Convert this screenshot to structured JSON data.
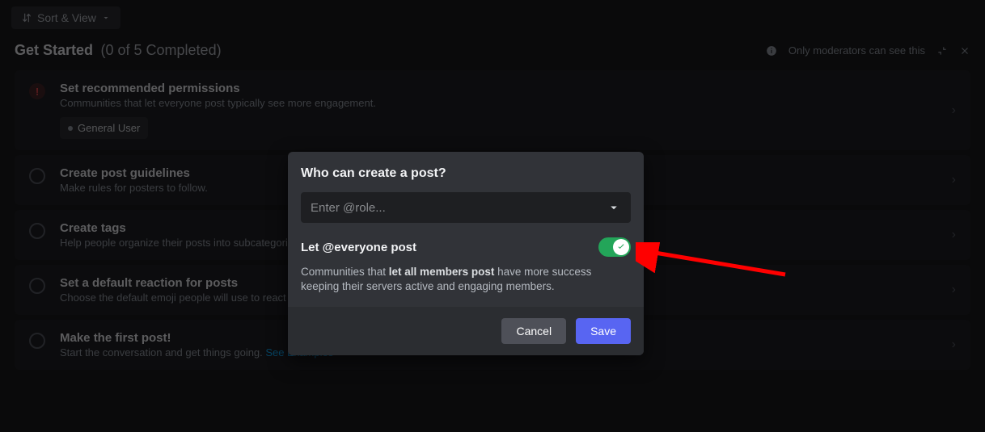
{
  "toolbar": {
    "sort_view": "Sort & View"
  },
  "header": {
    "title": "Get Started",
    "progress": "(0 of 5 Completed)",
    "mod_note": "Only moderators can see this"
  },
  "checklist": [
    {
      "title": "Set recommended permissions",
      "sub": "Communities that let everyone post typically see more engagement.",
      "chip": "General User",
      "warn": true
    },
    {
      "title": "Create post guidelines",
      "sub": "Make rules for posters to follow."
    },
    {
      "title": "Create tags",
      "sub": "Help people organize their posts into subcategories."
    },
    {
      "title": "Set a default reaction for posts",
      "sub": "Choose the default emoji people will use to react to posts."
    },
    {
      "title": "Make the first post!",
      "sub_prefix": "Start the conversation and get things going. ",
      "link": "See Examples"
    }
  ],
  "modal": {
    "title": "Who can create a post?",
    "role_placeholder": "Enter @role...",
    "toggle_label": "Let @everyone post",
    "desc_prefix": "Communities that ",
    "desc_bold": "let all members post",
    "desc_suffix": " have more success keeping their servers active and engaging members.",
    "cancel": "Cancel",
    "save": "Save"
  }
}
